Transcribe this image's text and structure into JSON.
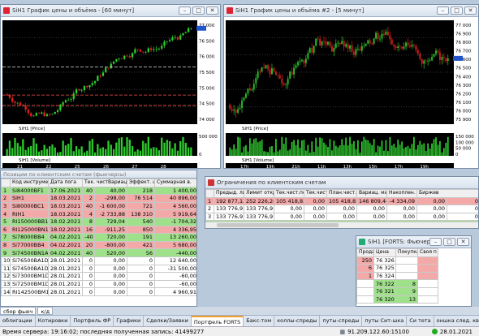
{
  "windows": {
    "chart1": {
      "title": "SiH1 График цены и объёма - [60 минут]",
      "price_label": "SiH1 [Price]",
      "volume_label": "SiH1 [Volume]",
      "price_ticks": [
        "77 000",
        "76 500",
        "76 000",
        "75 500",
        "75 000",
        "74 500",
        "74 000"
      ],
      "vol_ticks": [
        "500 000",
        "0"
      ],
      "x_ticks": [
        "21",
        "22",
        "25",
        "26",
        "27",
        "28"
      ]
    },
    "chart2": {
      "title": "SiH1 График цены и объёма #2 - [5 минут]",
      "price_label": "SiH1 [Price]",
      "volume_label": "SiH1 [Volume]",
      "price_ticks": [
        "77 000",
        "76 900",
        "76 800",
        "76 700",
        "76 600",
        "76 500",
        "76 400",
        "76 300",
        "76 200",
        "76 100",
        "76 000",
        "75 900"
      ],
      "vol_ticks": [
        "150 000",
        "100 000",
        "50 000",
        "0"
      ],
      "x_ticks": [
        "17h",
        "19h",
        "21h",
        "11h",
        "13h",
        "15h",
        "17h",
        "19h"
      ],
      "x_labels2": [
        "27",
        "28"
      ]
    },
    "positions": {
      "title": "Позиции по клиентским счетам (фьючерсы)",
      "headers": [
        "",
        "Код инструмента",
        "Дата пога",
        "Тек. чистВариац. марж",
        "Эффект. цена",
        "Суммарная в."
      ],
      "rows": [
        {
          "n": "1",
          "code": "Si84000BF1",
          "date": "17.06.2021",
          "pos": "40",
          "var": "40,00",
          "eff": "218",
          "sum": "1 400,00",
          "style": "g"
        },
        {
          "n": "2",
          "code": "SiH1",
          "date": "18.03.2021",
          "pos": "2",
          "var": "-298,00",
          "eff": "76 514",
          "sum": "40 896,00",
          "style": "r"
        },
        {
          "n": "3",
          "code": "Si80000BC1",
          "date": "18.03.2021",
          "pos": "40",
          "var": "-1 600,00",
          "eff": "721",
          "sum": "4 560,00",
          "style": "r"
        },
        {
          "n": "4",
          "code": "RIH1",
          "date": "18.03.2021",
          "pos": "4",
          "var": "-2 733,88",
          "eff": "138 310",
          "sum": "5 919,64",
          "style": "r"
        },
        {
          "n": "5",
          "code": "RI150000BB1",
          "date": "18.02.2021",
          "pos": "8",
          "var": "729,04",
          "eff": "540",
          "sum": "-1 704,32",
          "style": "g"
        },
        {
          "n": "6",
          "code": "RI125000BN1",
          "date": "18.02.2021",
          "pos": "16",
          "var": "-911,25",
          "eff": "850",
          "sum": "4 336,95",
          "style": "r"
        },
        {
          "n": "7",
          "code": "Si78000BB4",
          "date": "04.02.2021",
          "pos": "-40",
          "var": "720,00",
          "eff": "191",
          "sum": "13 260,00",
          "style": "g"
        },
        {
          "n": "8",
          "code": "Si77000BB4",
          "date": "04.02.2021",
          "pos": "20",
          "var": "-800,00",
          "eff": "421",
          "sum": "5 680,00",
          "style": "r"
        },
        {
          "n": "9",
          "code": "Si74500BN1A",
          "date": "04.02.2021",
          "pos": "40",
          "var": "520,00",
          "eff": "56",
          "sum": "-440,00",
          "style": "g"
        },
        {
          "n": "10",
          "code": "Si76500BA1D",
          "date": "28.01.2021",
          "pos": "0",
          "var": "0,00",
          "eff": "0",
          "sum": "12 640,00",
          "style": ""
        },
        {
          "n": "11",
          "code": "Si74500BA1D",
          "date": "28.01.2021",
          "pos": "0",
          "var": "0,00",
          "eff": "0",
          "sum": "-31 500,00",
          "style": ""
        },
        {
          "n": "12",
          "code": "Si73000BM1D",
          "date": "28.01.2021",
          "pos": "0",
          "var": "0,00",
          "eff": "0",
          "sum": "-60,00",
          "style": ""
        },
        {
          "n": "13",
          "code": "Si72500BM1D",
          "date": "28.01.2021",
          "pos": "0",
          "var": "0,00",
          "eff": "0",
          "sum": "-60,00",
          "style": ""
        },
        {
          "n": "14",
          "code": "RI142500BM1D",
          "date": "28.01.2021",
          "pos": "0",
          "var": "0,00",
          "eff": "0",
          "sum": "4 960,91",
          "style": ""
        }
      ]
    },
    "limits": {
      "title": "Ограничения по клиентским счетам",
      "headers": [
        "",
        "Предыд. лими",
        "Лимит откр. п",
        "Тек.чист.поз.",
        "Тек.чист.поз. (",
        "План.чист.поз.",
        "Вариац. маржа",
        "Накоплен. д",
        "Биржев"
      ],
      "rows": [
        {
          "n": "1",
          "c": [
            "192 877,12",
            "252 226,28",
            "105 418,82",
            "0,00",
            "105 418,82",
            "146 809,44",
            "-4 334,09",
            "0,00",
            "0"
          ],
          "style": "r"
        },
        {
          "n": "2",
          "c": [
            "133 776,91",
            "133 776,91",
            "0,00",
            "0,00",
            "0,00",
            "0,00",
            "0,00",
            "0,00",
            "0"
          ],
          "style": ""
        },
        {
          "n": "3",
          "c": [
            "133 776,91",
            "133 776,91",
            "0,00",
            "0,00",
            "0,00",
            "0,00",
            "0,00",
            "0,00",
            "0"
          ],
          "style": ""
        },
        {
          "n": "4",
          "c": [
            "496,04",
            "0,00",
            "74 427,77",
            "0,00",
            "35 823,10",
            "59 889,18",
            "-44,00",
            "496,04",
            "0"
          ],
          "style": "g"
        }
      ]
    },
    "orderbook": {
      "title": "SiH1 [FORTS: Фьючерсы",
      "headers": [
        "Продаж",
        "Цена",
        "ПокупкаСвоя",
        "Своя п"
      ],
      "rows": [
        {
          "sell": "250",
          "price": "76 326",
          "buy": "",
          "own": "",
          "style": "r"
        },
        {
          "sell": "6",
          "price": "76 325",
          "buy": "",
          "own": "",
          "style": "r"
        },
        {
          "sell": "1",
          "price": "76 324",
          "buy": "",
          "own": "",
          "style": "r"
        },
        {
          "sell": "",
          "price": "76 322",
          "buy": "8",
          "own": "",
          "style": "g"
        },
        {
          "sell": "",
          "price": "76 321",
          "buy": "9",
          "own": "",
          "style": "g"
        },
        {
          "sell": "",
          "price": "76 320",
          "buy": "13",
          "own": "",
          "style": "g"
        }
      ]
    }
  },
  "lower_tabs": [
    "сбор фьюч",
    "к/д"
  ],
  "tabs": [
    "облигации",
    "Котировки",
    "Портфель ФР",
    "Графики",
    "Сделки/Заявки",
    "Портфель FORTS",
    "Бакс-том",
    "коллы-спреды",
    "путы-спреды",
    "путы Сит-шка",
    "Си тета",
    "оншка след. квартал.",
    "опционы анализ",
    "опционы РТС",
    "нефть-",
    "яндекс"
  ],
  "active_tab": "Портфель FORTS",
  "status": {
    "server_time": "Время сервера: 19:16:02; последняя полученная запись: 41499277",
    "ip": "91.209.122.60:15100",
    "date": "28.01.2021"
  }
}
